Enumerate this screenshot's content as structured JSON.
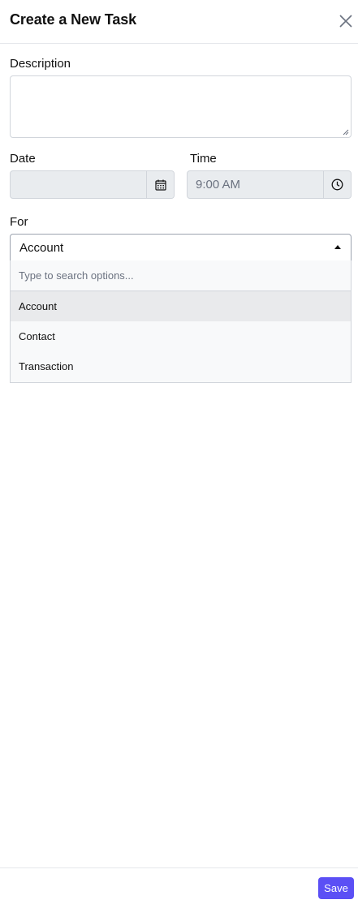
{
  "header": {
    "title": "Create a New Task"
  },
  "form": {
    "description": {
      "label": "Description",
      "value": ""
    },
    "date": {
      "label": "Date",
      "value": "",
      "icon": "calendar-icon"
    },
    "time": {
      "label": "Time",
      "value": "9:00 AM",
      "icon": "clock-icon"
    },
    "for": {
      "label": "For",
      "selected": "Account",
      "search_placeholder": "Type to search options...",
      "options": [
        "Account",
        "Contact",
        "Transaction"
      ],
      "highlighted_index": 0
    }
  },
  "footer": {
    "save_label": "Save"
  },
  "colors": {
    "accent": "#5b4ff5",
    "field_disabled_bg": "#e9ecef",
    "option_highlight": "#e9eaec"
  }
}
